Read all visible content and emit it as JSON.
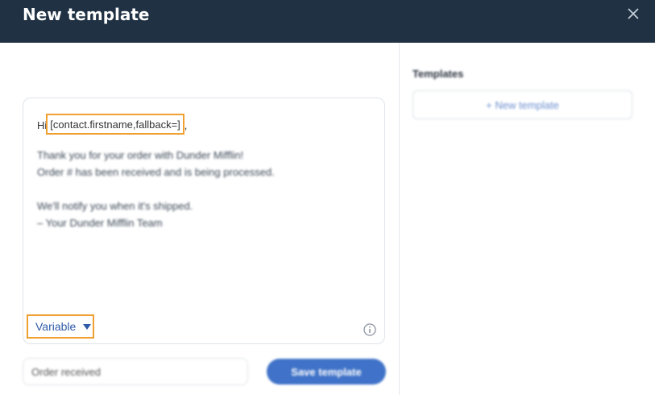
{
  "header": {
    "title": "New template",
    "close_icon": "close-icon"
  },
  "editor": {
    "greeting_prefix": "Hi",
    "variable_token": "[contact.firstname,fallback=]",
    "greeting_suffix": ",",
    "body_lines": [
      "Thank you for your order with Dunder Mifflin!",
      "Order # has been received and is being processed.",
      "",
      "We'll notify you when it's shipped.",
      "– Your Dunder Mifflin Team"
    ],
    "variable_button_label": "Variable",
    "info_icon": "info-icon"
  },
  "footer": {
    "name_input_value": "Order received",
    "save_button_label": "Save template"
  },
  "templates_panel": {
    "heading": "Templates",
    "new_template_label": "+ New template"
  }
}
